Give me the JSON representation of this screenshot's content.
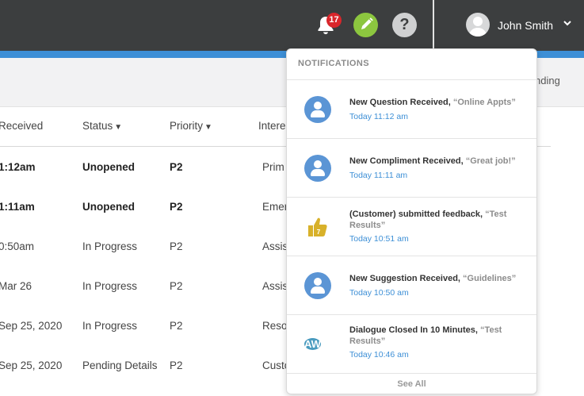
{
  "header": {
    "notification_count": "17",
    "user_name": "John Smith",
    "help_label": "?",
    "icons": {
      "bell": "bell-icon",
      "edit": "pencil-icon",
      "help": "question-icon",
      "user_menu": "chevron-down-icon"
    }
  },
  "subbar": {
    "pending_text": "nding"
  },
  "table": {
    "headers": {
      "received": "Received",
      "status": "Status",
      "priority": "Priority",
      "interest": "Intere"
    },
    "rows": [
      {
        "received": "1:12am",
        "status": "Unopened",
        "priority": "P2",
        "interest": "Prim"
      },
      {
        "received": "1:11am",
        "status": "Unopened",
        "priority": "P2",
        "interest": "Emer"
      },
      {
        "received": "0:50am",
        "status": "In Progress",
        "priority": "P2",
        "interest": "Assis"
      },
      {
        "received": "Mar 26",
        "status": "In Progress",
        "priority": "P2",
        "interest": "Assis"
      },
      {
        "received": "Sep 25, 2020",
        "status": "In Progress",
        "priority": "P2",
        "interest": "Reso"
      },
      {
        "received": "Sep 25, 2020",
        "status": "Pending Details",
        "priority": "P2",
        "interest": "Custo"
      }
    ]
  },
  "notifications": {
    "title": "NOTIFICATIONS",
    "see_all": "See All",
    "items": [
      {
        "icon": "user-avatar-icon",
        "title": "New Question Received,",
        "quote": "“Online Appts”",
        "time": "Today 11:12 am"
      },
      {
        "icon": "user-avatar-icon",
        "title": "New Compliment Received,",
        "quote": "“Great job!”",
        "time": "Today 11:11 am"
      },
      {
        "icon": "thumbs-up-icon",
        "icon_text": "7",
        "title": "(Customer) submitted feedback,",
        "quote": "“Test Results”",
        "time": "Today 10:51 am"
      },
      {
        "icon": "user-avatar-icon",
        "title": "New Suggestion Received,",
        "quote": "“Guidelines”",
        "time": "Today 10:50 am"
      },
      {
        "icon": "initials-avatar-icon",
        "icon_text": "AW",
        "title": "Dialogue Closed In 10 Minutes,",
        "quote": "“Test Results”",
        "time": "Today 10:46 am"
      }
    ]
  },
  "colors": {
    "topbar": "#3c3e3f",
    "accent": "#3d8fd6",
    "badge": "#d9262b",
    "edit": "#8cc63f",
    "avatar_blue": "#5b95d5",
    "initials_avatar": "#4a9bbf",
    "thumb": "#d8b12a"
  }
}
